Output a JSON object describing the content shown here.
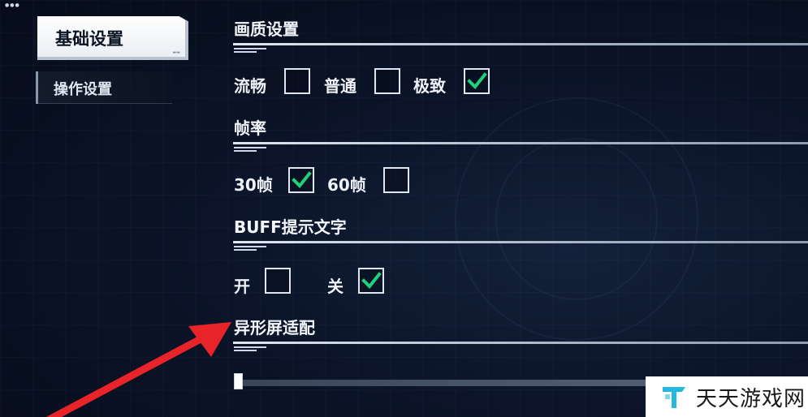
{
  "tabs": [
    {
      "label": "基础设置",
      "active": true
    },
    {
      "label": "操作设置",
      "active": false
    }
  ],
  "sections": {
    "quality": {
      "title": "画质设置",
      "options": [
        {
          "label": "流畅",
          "checked": false
        },
        {
          "label": "普通",
          "checked": false
        },
        {
          "label": "极致",
          "checked": true
        }
      ]
    },
    "framerate": {
      "title": "帧率",
      "options": [
        {
          "label": "30帧",
          "checked": true
        },
        {
          "label": "60帧",
          "checked": false
        }
      ]
    },
    "buff": {
      "title": "BUFF提示文字",
      "options": [
        {
          "label": "开",
          "checked": false
        },
        {
          "label": "关",
          "checked": true
        }
      ]
    },
    "notch": {
      "title": "异形屏适配",
      "slider_value": 0
    }
  },
  "watermark": {
    "text": "天天游戏网",
    "icon": "tt-logo-icon"
  },
  "annotation": {
    "icon": "red-arrow-icon",
    "color": "#e8232a"
  },
  "colors": {
    "check": "#1fd17a",
    "background": "#0b1428",
    "accent_logo": "#22b8e0"
  }
}
